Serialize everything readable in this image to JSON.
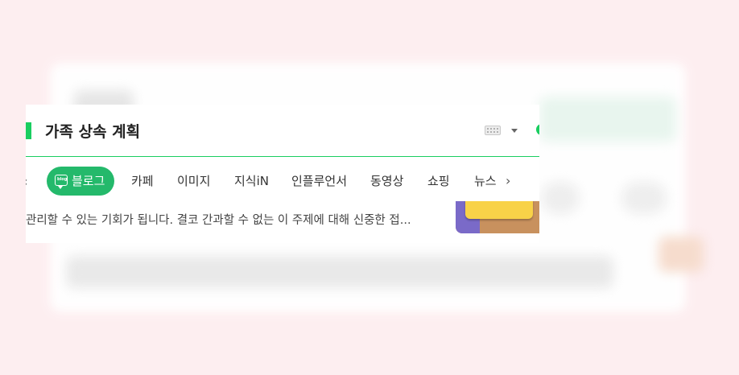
{
  "search": {
    "query": "가족 상속 계획"
  },
  "tabs": {
    "scroll_left_glyph": "‹",
    "scroll_right_glyph": "›",
    "items": [
      {
        "label": "블로그",
        "active": true
      },
      {
        "label": "카페",
        "active": false
      },
      {
        "label": "이미지",
        "active": false
      },
      {
        "label": "지식iN",
        "active": false
      },
      {
        "label": "인플루언서",
        "active": false
      },
      {
        "label": "동영상",
        "active": false
      },
      {
        "label": "쇼핑",
        "active": false
      },
      {
        "label": "뉴스",
        "active": false
      }
    ],
    "blog_icon_text": "blog"
  },
  "result": {
    "snippet": "관리할 수 있는 기회가 됩니다. 결코 간과할 수 없는 이 주제에 대해 신중한 접..."
  },
  "colors": {
    "accent": "#19ce60",
    "active_tab": "#24b96b",
    "page_bg": "#fdeef0"
  },
  "icons": [
    "keyboard-icon",
    "caret-down-icon",
    "blog-icon",
    "chevron-left-icon",
    "chevron-right-icon"
  ]
}
